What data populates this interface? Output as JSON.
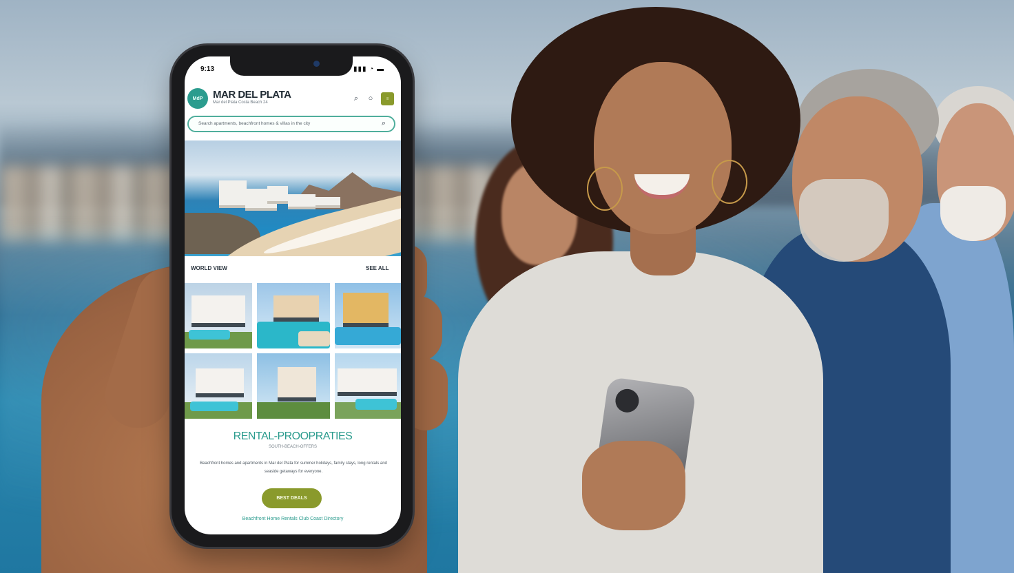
{
  "status_bar": {
    "time": "9:13",
    "icons": "▮▮▮ ◔ ▬"
  },
  "header": {
    "logo_text": "MdP",
    "title": "MAR DEL PLATA",
    "subtitle": "Mar del Plata Costa Beach 24",
    "search_icon": "search-icon",
    "chat_icon": "chat-icon",
    "menu_label": "≡"
  },
  "search": {
    "placeholder": "Search apartments, beachfront homes & villas in the city",
    "icon": "search-icon"
  },
  "section": {
    "left_label": "WORLD VIEW",
    "right_label": "SEE ALL"
  },
  "gallery": {
    "items": [
      {
        "name": "modern-villa"
      },
      {
        "name": "beach-resort"
      },
      {
        "name": "pool-hotel"
      },
      {
        "name": "garden-villa"
      },
      {
        "name": "beach-house"
      },
      {
        "name": "lake-villa"
      }
    ]
  },
  "rental": {
    "title": "RENTAL-PROOPRATIES",
    "subtitle": "SOUTH-BEACH-OFFERS",
    "body": "Beachfront homes and apartments in Mar del Plata for summer holidays, family stays, long rentals and seaside getaways for everyone.",
    "button_label": "BEST DEALS",
    "footer": "Beachfront Home Rentals Club Coast Directory"
  },
  "colors": {
    "brand_teal": "#2a9b8d",
    "brand_olive": "#8a9a2c",
    "search_border": "#4fae9c"
  }
}
